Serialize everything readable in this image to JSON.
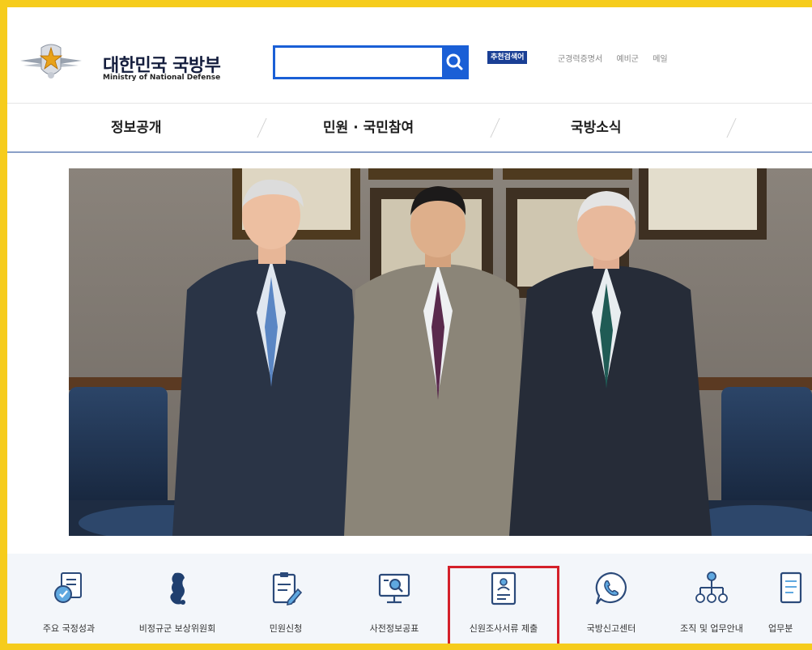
{
  "header": {
    "logo_ko": "대한민국 국방부",
    "logo_en": "Ministry of National Defense",
    "search_value": "",
    "recommend_badge": "추천검색어",
    "quicklinks": [
      "군경력증명서",
      "예비군",
      "메일"
    ]
  },
  "gnb": [
    "정보공개",
    "민원 · 국민참여",
    "국방소식"
  ],
  "quickmenu": [
    {
      "label": "주요 국정성과",
      "icon": "achievement-icon"
    },
    {
      "label": "비정규군 보상위원회",
      "icon": "korea-map-icon"
    },
    {
      "label": "민원신청",
      "icon": "application-icon"
    },
    {
      "label": "사전정보공표",
      "icon": "monitor-search-icon"
    },
    {
      "label": "신원조사서류 제출",
      "icon": "id-document-icon"
    },
    {
      "label": "국방신고센터",
      "icon": "phone-chat-icon"
    },
    {
      "label": "조직 및 업무안내",
      "icon": "org-chart-icon"
    },
    {
      "label": "업무분",
      "icon": "document-icon"
    }
  ],
  "colors": {
    "frame": "#f6cc1c",
    "accent": "#1a5fd6",
    "highlight": "#d4202a",
    "navy": "#141d3d"
  }
}
